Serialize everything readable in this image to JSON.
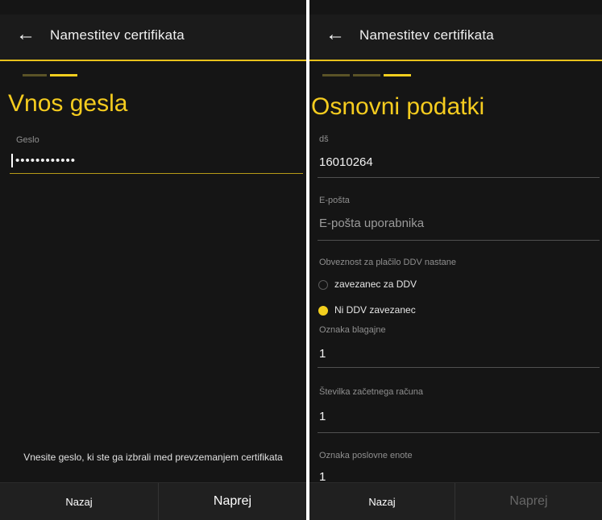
{
  "left": {
    "header": {
      "title": "Namestitev certifikata"
    },
    "page_title": "Vnos gesla",
    "password": {
      "label": "Geslo",
      "value": "••••••••••••"
    },
    "hint": "Vnesite geslo, ki ste ga izbrali med prevzemanjem certifikata",
    "buttons": {
      "back": "Nazaj",
      "next": "Naprej"
    }
  },
  "right": {
    "header": {
      "title": "Namestitev certifikata"
    },
    "page_title": "Osnovni podatki",
    "fields": {
      "ds": {
        "label": "dš",
        "value": "16010264"
      },
      "email": {
        "label": "E-pošta",
        "placeholder": "E-pošta uporabnika"
      },
      "vat": {
        "label": "Obveznost za plačilo DDV nastane",
        "options": [
          "zavezanec za DDV",
          "Ni DDV zavezanec"
        ],
        "selected": "Ni DDV zavezanec"
      },
      "register": {
        "label": "Oznaka blagajne",
        "value": "1"
      },
      "invoice_start": {
        "label": "Številka začetnega računa",
        "value": "1"
      },
      "business_unit": {
        "label": "Oznaka poslovne enote",
        "value": "1"
      }
    },
    "buttons": {
      "back": "Nazaj",
      "next": "Naprej"
    }
  },
  "colors": {
    "accent": "#f3cf1e",
    "background": "#151515"
  }
}
